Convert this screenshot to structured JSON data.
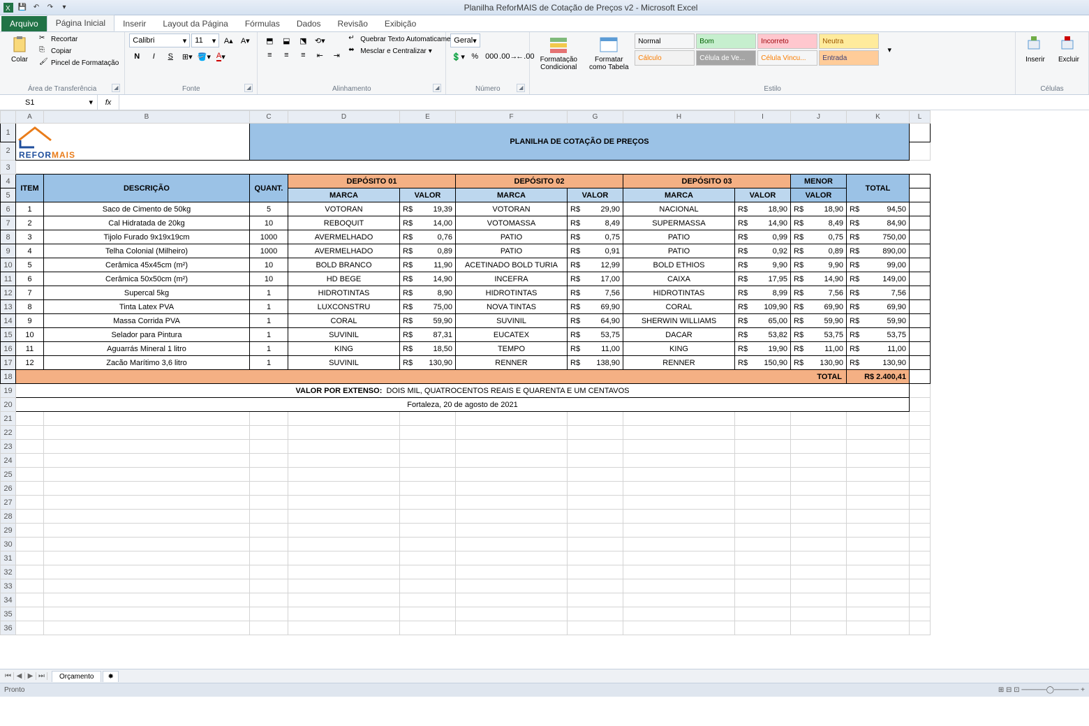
{
  "window": {
    "title": "Planilha ReforMAIS de Cotação de Preços v2  -  Microsoft Excel"
  },
  "tabs": {
    "file": "Arquivo",
    "home": "Página Inicial",
    "insert": "Inserir",
    "layout": "Layout da Página",
    "formulas": "Fórmulas",
    "data": "Dados",
    "review": "Revisão",
    "view": "Exibição"
  },
  "ribbon": {
    "clipboard": {
      "label": "Área de Transferência",
      "paste": "Colar",
      "cut": "Recortar",
      "copy": "Copiar",
      "painter": "Pincel de Formatação"
    },
    "font": {
      "label": "Fonte",
      "name": "Calibri",
      "size": "11"
    },
    "align": {
      "label": "Alinhamento",
      "wrap": "Quebrar Texto Automaticamente",
      "merge": "Mesclar e Centralizar"
    },
    "number": {
      "label": "Número",
      "format": "Geral"
    },
    "styles": {
      "cond": "Formatação Condicional",
      "table": "Formatar como Tabela",
      "s_normal": "Normal",
      "s_bom": "Bom",
      "s_incorreto": "Incorreto",
      "s_neutra": "Neutra",
      "s_calculo": "Cálculo",
      "s_celula": "Célula de Ve...",
      "s_vincu": "Célula Vincu...",
      "s_entrada": "Entrada",
      "label": "Estilo"
    },
    "cells": {
      "insert": "Inserir",
      "delete": "Excluir",
      "label": "Células"
    }
  },
  "namebox": "S1",
  "sheet": {
    "title": "PLANILHA DE COTAÇÃO DE PREÇOS",
    "logo": {
      "l1": "REFOR",
      "l2": "MAIS"
    },
    "h_item": "ITEM",
    "h_desc": "DESCRIÇÃO",
    "h_quant": "QUANT.",
    "h_dep1": "DEPÓSITO 01",
    "h_dep2": "DEPÓSITO 02",
    "h_dep3": "DEPÓSITO 03",
    "h_marca": "MARCA",
    "h_valor": "VALOR",
    "h_menor": "MENOR",
    "h_menor2": "VALOR",
    "h_total": "TOTAL",
    "rows": [
      {
        "n": "1",
        "d": "Saco de Cimento de 50kg",
        "q": "5",
        "m1": "VOTORAN",
        "v1": "19,39",
        "m2": "VOTORAN",
        "v2": "29,90",
        "m3": "NACIONAL",
        "v3": "18,90",
        "mn": "18,90",
        "t": "94,50"
      },
      {
        "n": "2",
        "d": "Cal Hidratada de 20kg",
        "q": "10",
        "m1": "REBOQUIT",
        "v1": "14,00",
        "m2": "VOTOMASSA",
        "v2": "8,49",
        "m3": "SUPERMASSA",
        "v3": "14,90",
        "mn": "8,49",
        "t": "84,90"
      },
      {
        "n": "3",
        "d": "Tijolo Furado 9x19x19cm",
        "q": "1000",
        "m1": "AVERMELHADO",
        "v1": "0,76",
        "m2": "PATIO",
        "v2": "0,75",
        "m3": "PATIO",
        "v3": "0,99",
        "mn": "0,75",
        "t": "750,00"
      },
      {
        "n": "4",
        "d": "Telha Colonial (Milheiro)",
        "q": "1000",
        "m1": "AVERMELHADO",
        "v1": "0,89",
        "m2": "PATIO",
        "v2": "0,91",
        "m3": "PATIO",
        "v3": "0,92",
        "mn": "0,89",
        "t": "890,00"
      },
      {
        "n": "5",
        "d": "Cerâmica 45x45cm (m²)",
        "q": "10",
        "m1": "BOLD BRANCO",
        "v1": "11,90",
        "m2": "ACETINADO BOLD TURIA",
        "v2": "12,99",
        "m3": "BOLD ETHIOS",
        "v3": "9,90",
        "mn": "9,90",
        "t": "99,00"
      },
      {
        "n": "6",
        "d": "Cerâmica 50x50cm (m²)",
        "q": "10",
        "m1": "HD BEGE",
        "v1": "14,90",
        "m2": "INCEFRA",
        "v2": "17,00",
        "m3": "CAIXA",
        "v3": "17,95",
        "mn": "14,90",
        "t": "149,00"
      },
      {
        "n": "7",
        "d": "Supercal 5kg",
        "q": "1",
        "m1": "HIDROTINTAS",
        "v1": "8,90",
        "m2": "HIDROTINTAS",
        "v2": "7,56",
        "m3": "HIDROTINTAS",
        "v3": "8,99",
        "mn": "7,56",
        "t": "7,56"
      },
      {
        "n": "8",
        "d": "Tinta Latex PVA",
        "q": "1",
        "m1": "LUXCONSTRU",
        "v1": "75,00",
        "m2": "NOVA TINTAS",
        "v2": "69,90",
        "m3": "CORAL",
        "v3": "109,90",
        "mn": "69,90",
        "t": "69,90"
      },
      {
        "n": "9",
        "d": "Massa Corrida PVA",
        "q": "1",
        "m1": "CORAL",
        "v1": "59,90",
        "m2": "SUVINIL",
        "v2": "64,90",
        "m3": "SHERWIN WILLIAMS",
        "v3": "65,00",
        "mn": "59,90",
        "t": "59,90"
      },
      {
        "n": "10",
        "d": "Selador para Pintura",
        "q": "1",
        "m1": "SUVINIL",
        "v1": "87,31",
        "m2": "EUCATEX",
        "v2": "53,75",
        "m3": "DACAR",
        "v3": "53,82",
        "mn": "53,75",
        "t": "53,75"
      },
      {
        "n": "11",
        "d": "Aguarrás Mineral 1 litro",
        "q": "1",
        "m1": "KING",
        "v1": "18,50",
        "m2": "TEMPO",
        "v2": "11,00",
        "m3": "KING",
        "v3": "19,90",
        "mn": "11,00",
        "t": "11,00"
      },
      {
        "n": "12",
        "d": "Zacão Marítimo 3,6 litro",
        "q": "1",
        "m1": "SUVINIL",
        "v1": "130,90",
        "m2": "RENNER",
        "v2": "138,90",
        "m3": "RENNER",
        "v3": "150,90",
        "mn": "130,90",
        "t": "130,90"
      }
    ],
    "total_label": "TOTAL",
    "total_value": "R$ 2.400,41",
    "extenso_label": "VALOR POR EXTENSO:",
    "extenso_value": "DOIS MIL, QUATROCENTOS REAIS E QUARENTA E UM CENTAVOS",
    "local_data": "Fortaleza,   20 de agosto de 2021",
    "rs": "R$"
  },
  "sheettab": "Orçamento",
  "status": "Pronto",
  "cols": [
    "A",
    "B",
    "C",
    "D",
    "E",
    "F",
    "G",
    "H",
    "I",
    "J",
    "K",
    "L"
  ]
}
